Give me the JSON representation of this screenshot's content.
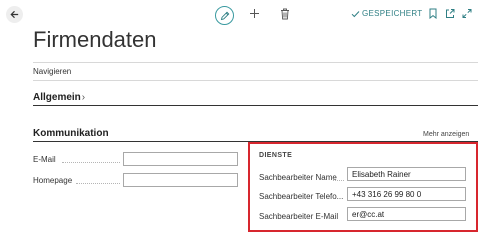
{
  "page": {
    "title": "Firmendaten",
    "saved_status": "GESPEICHERT"
  },
  "toolbar": {
    "back_icon": "arrow-left-icon",
    "edit_icon": "pencil-icon",
    "new_icon": "plus-icon",
    "delete_icon": "trash-icon",
    "bookmark_icon": "bookmark-icon",
    "share_icon": "open-in-new-icon",
    "expand_icon": "expand-icon"
  },
  "navigate": {
    "label": "Navigieren"
  },
  "sections": {
    "general": {
      "title": "Allgemein",
      "chevron": "›"
    },
    "communication": {
      "title": "Kommunikation",
      "show_more": "Mehr anzeigen",
      "fields": [
        {
          "label": "E-Mail",
          "value": ""
        },
        {
          "label": "Homepage",
          "value": ""
        }
      ]
    },
    "services": {
      "title": "DIENSTE",
      "fields": [
        {
          "label": "Sachbearbeiter Name",
          "value": "Elisabeth Rainer"
        },
        {
          "label": "Sachbearbeiter Telefo...",
          "value": "+43 316 26 99 80 0"
        },
        {
          "label": "Sachbearbeiter E-Mail",
          "value": "er@cc.at"
        }
      ]
    }
  },
  "colors": {
    "accent": "#2f7f84",
    "highlight_border": "#d7262e"
  }
}
